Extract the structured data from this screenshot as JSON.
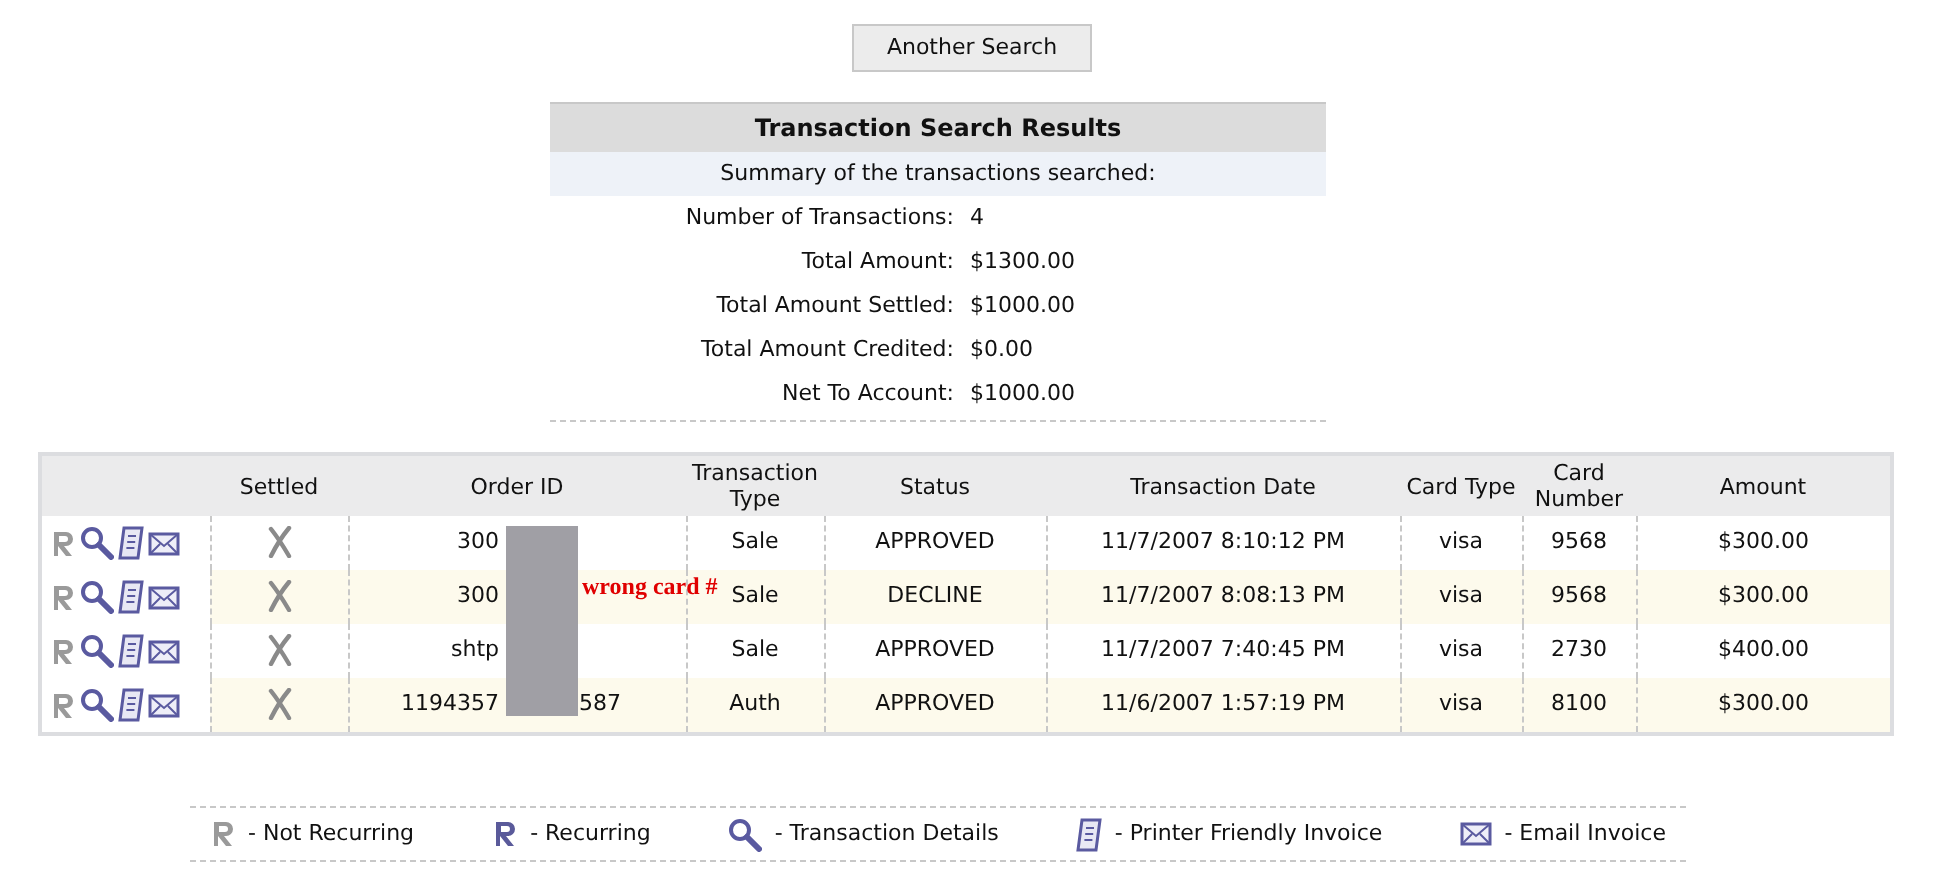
{
  "another_search_button": "Another Search",
  "summary": {
    "title": "Transaction Search Results",
    "subtitle": "Summary of the transactions searched:",
    "rows": [
      {
        "label": "Number of Transactions:",
        "value": "4"
      },
      {
        "label": "Total Amount:",
        "value": "$1300.00"
      },
      {
        "label": "Total Amount Settled:",
        "value": "$1000.00"
      },
      {
        "label": "Total Amount Credited:",
        "value": "$0.00"
      },
      {
        "label": "Net To Account:",
        "value": "$1000.00"
      }
    ]
  },
  "table": {
    "columns": [
      "Settled",
      "Order ID",
      "Transaction Type",
      "Status",
      "Transaction Date",
      "Card Type",
      "Card Number",
      "Amount"
    ],
    "rows": [
      {
        "recurring": false,
        "settled": false,
        "order_id": [
          "300"
        ],
        "type": "Sale",
        "status": "APPROVED",
        "date": "11/7/2007 8:10:12 PM",
        "card_type": "visa",
        "card_number": "9568",
        "amount": "$300.00"
      },
      {
        "recurring": false,
        "settled": false,
        "order_id": [
          "300"
        ],
        "type": "Sale",
        "status": "DECLINE",
        "date": "11/7/2007 8:08:13 PM",
        "card_type": "visa",
        "card_number": "9568",
        "amount": "$300.00"
      },
      {
        "recurring": false,
        "settled": false,
        "order_id": [
          "shtp"
        ],
        "type": "Sale",
        "status": "APPROVED",
        "date": "11/7/2007 7:40:45 PM",
        "card_type": "visa",
        "card_number": "2730",
        "amount": "$400.00"
      },
      {
        "recurring": false,
        "settled": false,
        "order_id": [
          "1194357",
          "587"
        ],
        "type": "Auth",
        "status": "APPROVED",
        "date": "11/6/2007 1:57:19 PM",
        "card_type": "visa",
        "card_number": "8100",
        "amount": "$300.00"
      }
    ]
  },
  "annotation": "wrong card #",
  "legend": [
    {
      "kind": "not_recurring",
      "label": "- Not Recurring"
    },
    {
      "kind": "recurring",
      "label": "- Recurring"
    },
    {
      "kind": "details",
      "label": "- Transaction Details"
    },
    {
      "kind": "invoice",
      "label": "- Printer Friendly Invoice"
    },
    {
      "kind": "email",
      "label": "- Email Invoice"
    }
  ]
}
